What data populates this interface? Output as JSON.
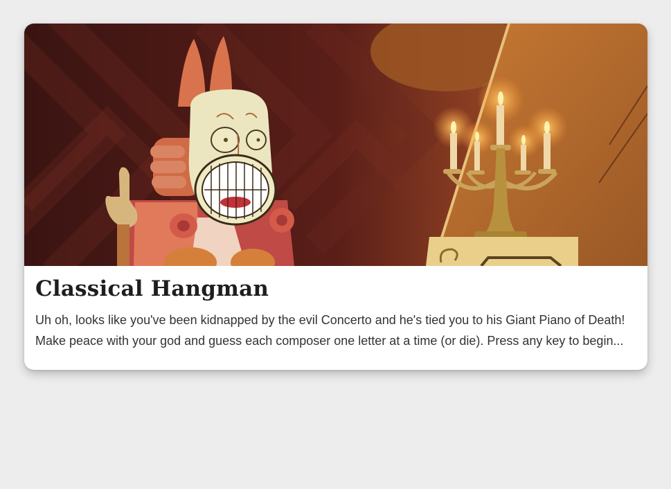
{
  "card": {
    "image_alt": "Concerto at the Giant Piano of Death",
    "title": "Classical Hangman",
    "description": "Uh oh, looks like you've been kidnapped by the evil Concerto and he's tied you to his Giant Piano of Death! Make peace with your god and guess each composer one letter at a time (or die). Press any key to begin..."
  },
  "colors": {
    "page_bg": "#ededed",
    "card_bg": "#ffffff",
    "title_text": "#1e1e1e",
    "body_text": "#333333",
    "hero_dark": "#3a1412",
    "hero_warm": "#b8642a"
  }
}
